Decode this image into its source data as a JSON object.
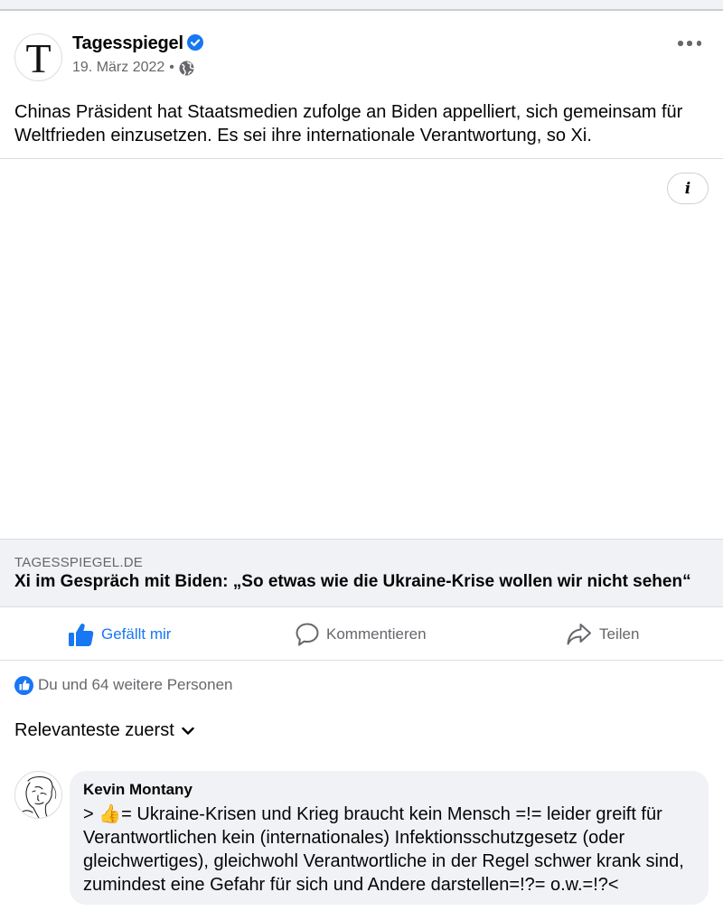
{
  "post": {
    "author": "Tagesspiegel",
    "author_avatar_letter": "T",
    "verified": true,
    "date": "19. März 2022",
    "separator": "•",
    "privacy_icon": "globe-icon",
    "text": "Chinas Präsident hat Staatsmedien zufolge an Biden appelliert, sich gemeinsam für Weltfrieden einzusetzen. Es sei ihre internationale Verantwortung, so Xi.",
    "info_label": "i"
  },
  "link_preview": {
    "domain": "TAGESSPIEGEL.DE",
    "title": "Xi im Gespräch mit Biden: „So etwas wie die Ukraine-Krise wollen wir nicht sehen“"
  },
  "actions": {
    "like_label": "Gefällt mir",
    "comment_label": "Kommentieren",
    "share_label": "Teilen"
  },
  "reactions": {
    "summary": "Du und 64 weitere Personen"
  },
  "comments_sort": {
    "label": "Relevanteste zuerst"
  },
  "comments": [
    {
      "author": "Kevin Montany",
      "text": "> 👍= Ukraine-Krisen und Krieg braucht kein Mensch =!= leider greift für Verantwortlichen kein (internationales) Infektionsschutzgesetz (oder gleichwertiges), gleichwohl Verantwortliche in der Regel schwer krank sind, zumindest eine Gefahr für sich und Andere darstellen=!?= o.w.=!?<"
    }
  ],
  "colors": {
    "accent": "#1877f2",
    "secondary_text": "#65676b",
    "bubble": "#f0f2f5"
  }
}
